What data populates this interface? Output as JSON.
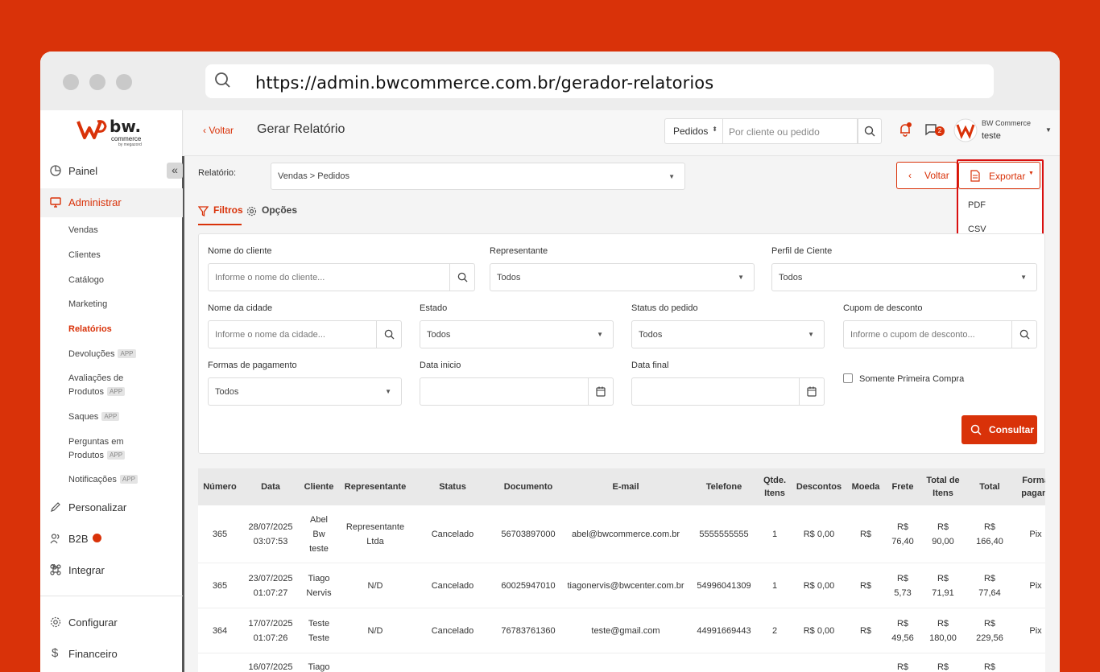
{
  "browser": {
    "url": "https://admin.bwcommerce.com.br/gerador-relatorios"
  },
  "logo": {
    "brand": "bw.",
    "sub": "commerce",
    "by": "by megazord"
  },
  "sidebar": {
    "main": [
      {
        "label": "Painel"
      },
      {
        "label": "Administrar"
      },
      {
        "label": "Personalizar"
      },
      {
        "label": "B2B"
      },
      {
        "label": "Integrar"
      },
      {
        "label": "Configurar"
      },
      {
        "label": "Financeiro"
      }
    ],
    "sub": [
      {
        "label": "Vendas"
      },
      {
        "label": "Clientes"
      },
      {
        "label": "Catálogo"
      },
      {
        "label": "Marketing"
      },
      {
        "label": "Relatórios"
      },
      {
        "label": "Devoluções",
        "tag": "APP"
      },
      {
        "label": "Avaliações de",
        "label2": "Produtos",
        "tag": "APP"
      },
      {
        "label": "Saques",
        "tag": "APP"
      },
      {
        "label": "Perguntas em",
        "label2": "Produtos",
        "tag": "APP"
      },
      {
        "label": "Notificações",
        "tag": "APP"
      }
    ]
  },
  "header": {
    "back": "Voltar",
    "title": "Gerar Relatório",
    "select": "Pedidos",
    "search_placeholder": "Por cliente ou pedido",
    "chat_count": "2",
    "user_name": "BW Commerce",
    "user_role": "teste"
  },
  "report": {
    "label": "Relatório:",
    "value": "Vendas > Pedidos",
    "voltar": "Voltar",
    "exportar": "Exportar",
    "export_options": [
      "PDF",
      "CSV"
    ]
  },
  "tabs": {
    "filtros": "Filtros",
    "opcoes": "Opções"
  },
  "filters": {
    "cliente_label": "Nome do cliente",
    "cliente_placeholder": "Informe o nome do cliente...",
    "representante_label": "Representante",
    "representante_value": "Todos",
    "perfil_label": "Perfil de Ciente",
    "perfil_value": "Todos",
    "cidade_label": "Nome da cidade",
    "cidade_placeholder": "Informe o nome da cidade...",
    "estado_label": "Estado",
    "estado_value": "Todos",
    "status_label": "Status do pedido",
    "status_value": "Todos",
    "cupom_label": "Cupom de desconto",
    "cupom_placeholder": "Informe o cupom de desconto...",
    "pagamento_label": "Formas de pagamento",
    "pagamento_value": "Todos",
    "inicio_label": "Data inicio",
    "final_label": "Data final",
    "primeira_compra": "Somente Primeira Compra",
    "consultar": "Consultar"
  },
  "table": {
    "headers": [
      "Número",
      "Data",
      "Cliente",
      "Representante",
      "Status",
      "Documento",
      "E-mail",
      "Telefone",
      "Qtde.|Itens",
      "Descontos",
      "Moeda",
      "Frete",
      "Total de|Itens",
      "Total",
      "Forma|pagam"
    ],
    "rows": [
      [
        "365",
        "28/07/2025|03:07:53",
        "Abel|Bw|teste",
        "Representante|Ltda",
        "Cancelado",
        "56703897000",
        "abel@bwcommerce.com.br",
        "5555555555",
        "1",
        "R$ 0,00",
        "R$",
        "R$|76,40",
        "R$|90,00",
        "R$|166,40",
        "Pix"
      ],
      [
        "365",
        "23/07/2025|01:07:27",
        "Tiago|Nervis",
        "N/D",
        "Cancelado",
        "60025947010",
        "tiagonervis@bwcenter.com.br",
        "54996041309",
        "1",
        "R$ 0,00",
        "R$",
        "R$|5,73",
        "R$|71,91",
        "R$|77,64",
        "Pix"
      ],
      [
        "364",
        "17/07/2025|01:07:26",
        "Teste|Teste",
        "N/D",
        "Cancelado",
        "76783761360",
        "teste@gmail.com",
        "44991669443",
        "2",
        "R$ 0,00",
        "R$",
        "R$|49,56",
        "R$|180,00",
        "R$|229,56",
        "Pix"
      ],
      [
        "",
        "16/07/2025",
        "Tiago",
        "",
        "",
        "",
        "",
        "",
        "",
        "",
        "",
        "R$",
        "R$",
        "R$",
        ""
      ]
    ]
  },
  "colors": {
    "accent": "#d93209",
    "highlight": "#d91010"
  }
}
